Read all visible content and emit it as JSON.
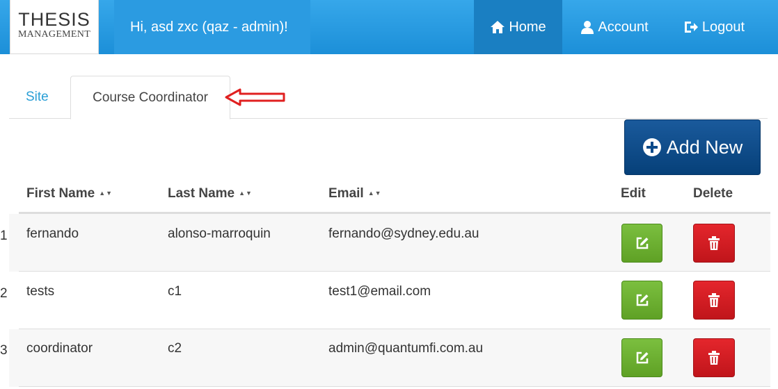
{
  "header": {
    "logo_line1": "THESIS",
    "logo_line2": "MANAGEMENT",
    "greeting": "Hi, asd zxc (qaz - admin)!",
    "nav": [
      {
        "label": "Home",
        "icon": "home-icon"
      },
      {
        "label": "Account",
        "icon": "user-icon"
      },
      {
        "label": "Logout",
        "icon": "logout-icon"
      }
    ]
  },
  "tabs": [
    {
      "label": "Site",
      "active": false
    },
    {
      "label": "Course Coordinator",
      "active": true
    }
  ],
  "add_button": {
    "label": "Add New",
    "icon": "plus-circle-icon"
  },
  "table": {
    "columns": [
      "First Name",
      "Last Name",
      "Email",
      "Edit",
      "Delete"
    ],
    "sort_glyph": "▲▼",
    "rows": [
      {
        "index": "1",
        "first": "fernando",
        "last": "alonso-marroquin",
        "email": "fernando@sydney.edu.au"
      },
      {
        "index": "2",
        "first": "tests",
        "last": "c1",
        "email": "test1@email.com"
      },
      {
        "index": "3",
        "first": "coordinator",
        "last": "c2",
        "email": "admin@quantumfi.com.au"
      }
    ]
  },
  "colors": {
    "header_blue": "#1c8fd8",
    "add_button_navy": "#0b4a8a",
    "edit_green": "#6db032",
    "delete_red": "#d41f25",
    "annotation_arrow": "#e02020"
  }
}
